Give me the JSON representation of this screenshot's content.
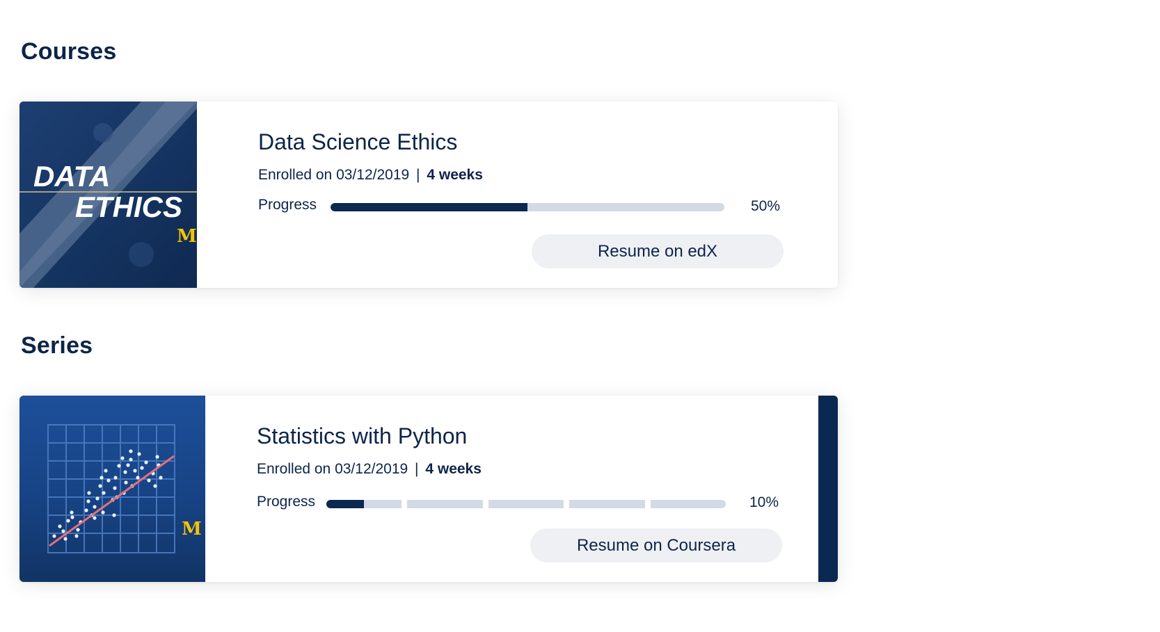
{
  "courses_heading": "Courses",
  "series_heading": "Series",
  "course": {
    "thumbnail_text_line1": "DATA",
    "thumbnail_text_line2": "ETHICS",
    "thumbnail_logo": "M",
    "title": "Data Science Ethics",
    "enrolled_text": "Enrolled on 03/12/2019",
    "separator": "|",
    "duration": "4 weeks",
    "progress_label": "Progress",
    "progress_value": 0.5,
    "progress_text": "50%",
    "resume_label": "Resume on edX"
  },
  "series": {
    "thumbnail_logo": "M",
    "title": "Statistics with Python",
    "enrolled_text": "Enrolled on 03/12/2019",
    "separator": "|",
    "duration": "4 weeks",
    "progress_label": "Progress",
    "progress_value": 0.1,
    "segment_count": 5,
    "progress_text": "10%",
    "resume_label": "Resume on Coursera"
  },
  "colors": {
    "navy": "#0d2449",
    "track": "#d2dbe5",
    "fill": "#0b2850",
    "button_bg": "#eef0f3",
    "maize": "#f5c400"
  }
}
